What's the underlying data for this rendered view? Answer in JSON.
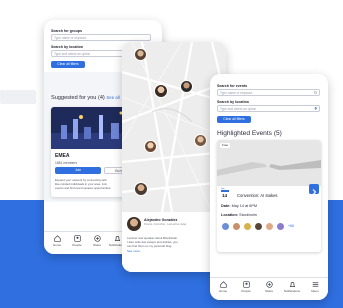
{
  "colors": {
    "accent": "#2f6fe0",
    "band": "#2f6fe0",
    "background": "#ffffff"
  },
  "screen1": {
    "search_groups_label": "Search for groups",
    "search_groups_placeholder": "Type name or keyword",
    "search_location_label": "Search by location",
    "search_location_placeholder": "Type and select an option",
    "clear_filters_label": "Clear all filters",
    "suggested_title": "Suggested for you (4)",
    "see_all": "See all",
    "group_name": "EMEA",
    "group_members": "1681 members",
    "join_label": "Join",
    "go_to_group_label": "Go to group",
    "group_desc": [
      "Expand your network by connecting with",
      "like-minded individuals in your area. Join",
      "events and find new business opportunities."
    ],
    "nav": [
      "Home",
      "People",
      "Share",
      "Notifications",
      "Menu"
    ]
  },
  "screen2": {
    "author_name": "Alejandro González",
    "author_meta": "Pereira, Colombia · Last active today",
    "bio": [
      "Lecturer and speaker about Blockchain.",
      "I also write few essays and articles, you",
      "can find them on my personal blog."
    ],
    "see_more": "See more"
  },
  "screen3": {
    "search_events_label": "Search for events",
    "search_events_placeholder": "Type name or keyword",
    "search_location_label": "Search by location",
    "search_location_placeholder": "Type and select an option",
    "clear_filters_label": "Clear all filters",
    "highlighted_title": "Highlighted Events (5)",
    "free_badge": "Free",
    "event_month": "Nov",
    "event_day": "14",
    "event_title": "Convention: AI stakes",
    "date_label": "Date:",
    "date_value": "May 14 at 6PM",
    "location_label": "Location:",
    "location_value": "Stockholm",
    "attendees_more": "+66",
    "nav": [
      "Home",
      "People",
      "Share",
      "Notifications",
      "Menu"
    ]
  },
  "icons": [
    "search-icon",
    "location-pin-icon",
    "home-icon",
    "people-icon",
    "share-icon",
    "bell-icon",
    "menu-icon",
    "chevron-right-icon"
  ]
}
